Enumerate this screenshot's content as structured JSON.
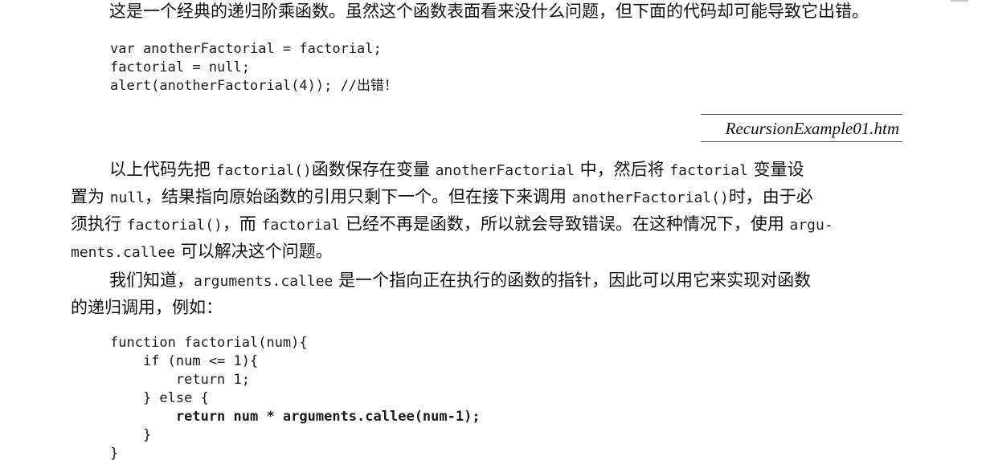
{
  "intro_line": "这是一个经典的递归阶乘函数。虽然这个函数表面看来没什么问题，但下面的代码却可能导致它出错。",
  "code1": [
    "var anotherFactorial = factorial;",
    "factorial = null;",
    "alert(anotherFactorial(4)); //出错！"
  ],
  "caption": "RecursionExample01.htm",
  "para1": {
    "l1": [
      "以上代码先把 ",
      "factorial()",
      "函数保存在变量 ",
      "anotherFactorial",
      " 中，然后将 ",
      "factorial",
      " 变量设"
    ],
    "l2": [
      "置为 ",
      "null",
      "，结果指向原始函数的引用只剩下一个。但在接下来调用 ",
      "anotherFactorial()",
      "时，由于必"
    ],
    "l3": [
      "须执行 ",
      "factorial()",
      "，而 ",
      "factorial",
      " 已经不再是函数，所以就会导致错误。在这种情况下，使用 ",
      "argu-"
    ],
    "l4": [
      "ments.callee",
      " 可以解决这个问题。"
    ]
  },
  "para2": {
    "l1": [
      "我们知道，",
      "arguments.callee",
      " 是一个指向正在执行的函数的指针，因此可以用它来实现对函数"
    ],
    "l2": "的递归调用，例如："
  },
  "code2": [
    "function factorial(num){",
    "    if (num <= 1){",
    "        return 1;",
    "    } else {",
    "        return num * arguments.callee(num-1);",
    "    }",
    "}"
  ]
}
